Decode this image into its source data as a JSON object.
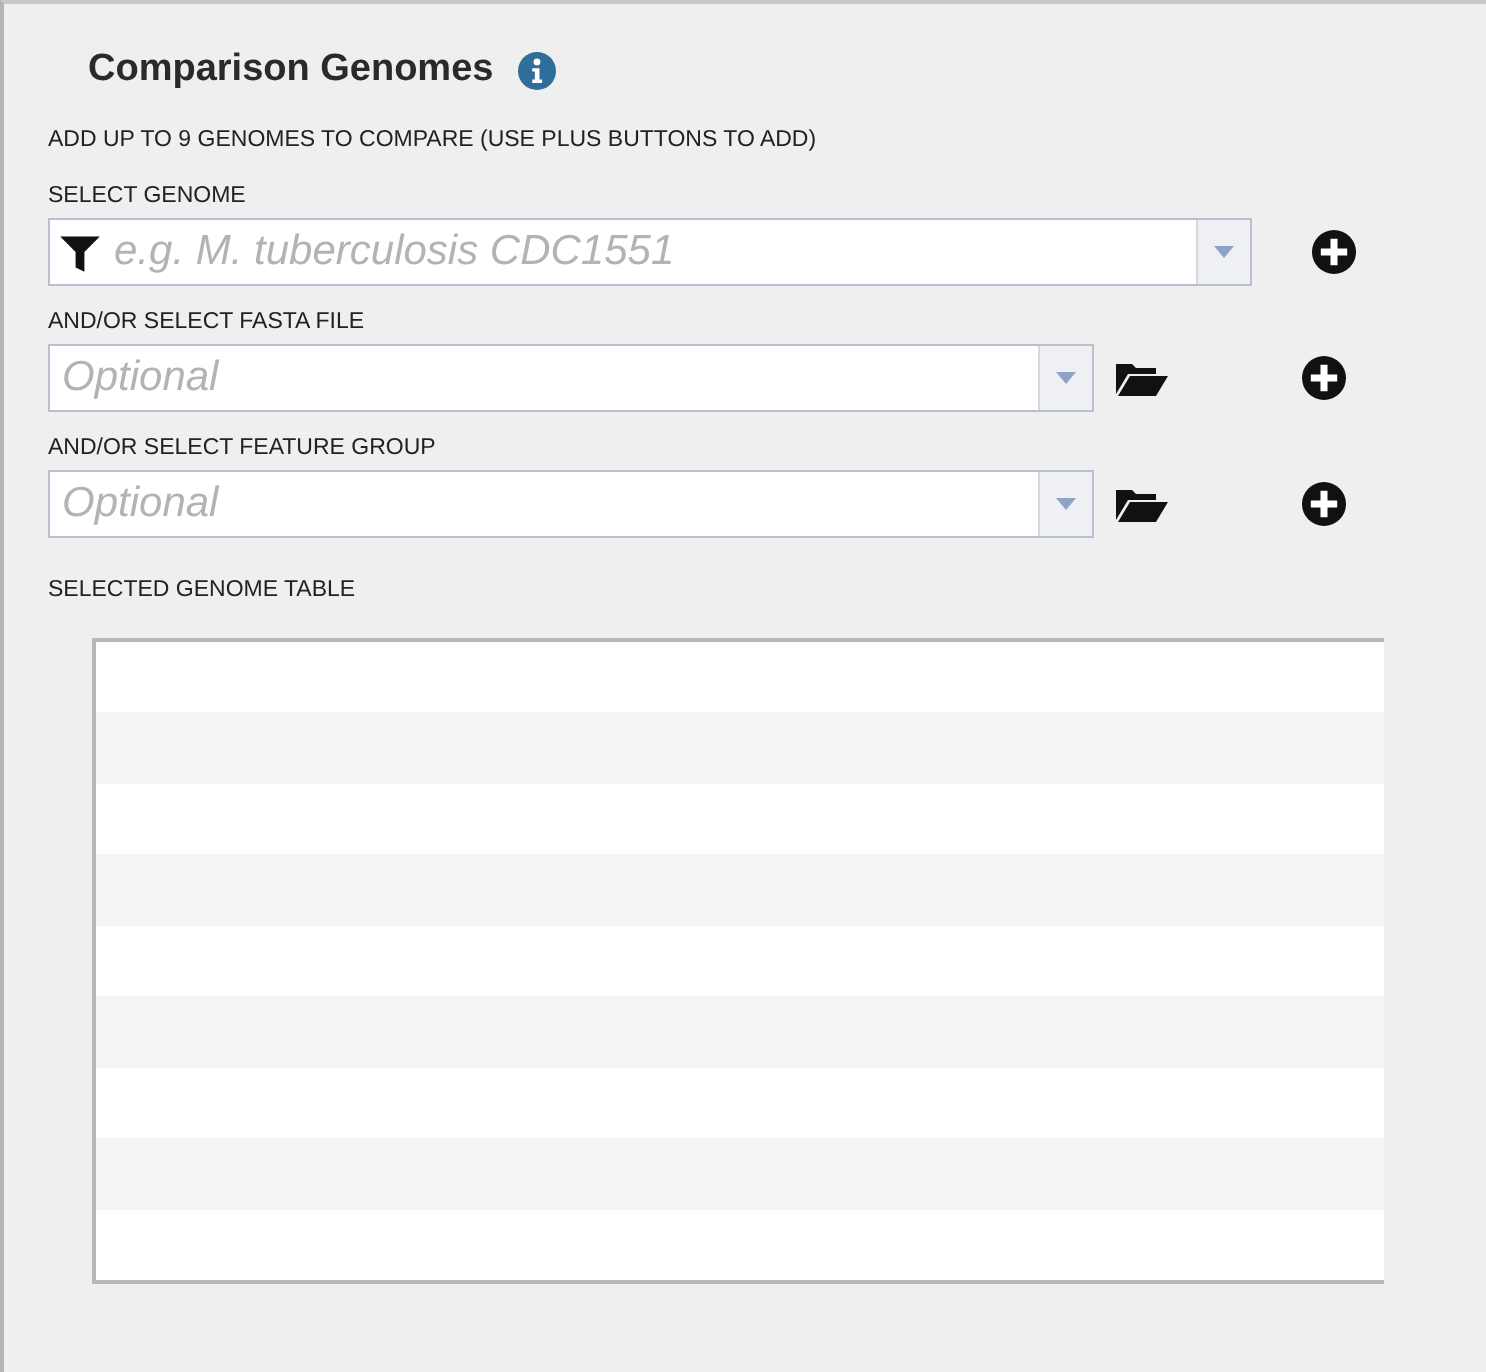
{
  "panel": {
    "title": "Comparison Genomes",
    "instruction": "ADD UP TO 9 GENOMES TO COMPARE (USE PLUS BUTTONS TO ADD)",
    "selectors": [
      {
        "kind": "genome",
        "label": "SELECT GENOME",
        "placeholder": "e.g. M. tuberculosis CDC1551"
      },
      {
        "kind": "file",
        "label": "AND/OR SELECT FASTA FILE",
        "placeholder": "Optional"
      },
      {
        "kind": "file",
        "label": "AND/OR SELECT FEATURE GROUP",
        "placeholder": "Optional"
      }
    ],
    "table_label": "SELECTED GENOME TABLE"
  }
}
